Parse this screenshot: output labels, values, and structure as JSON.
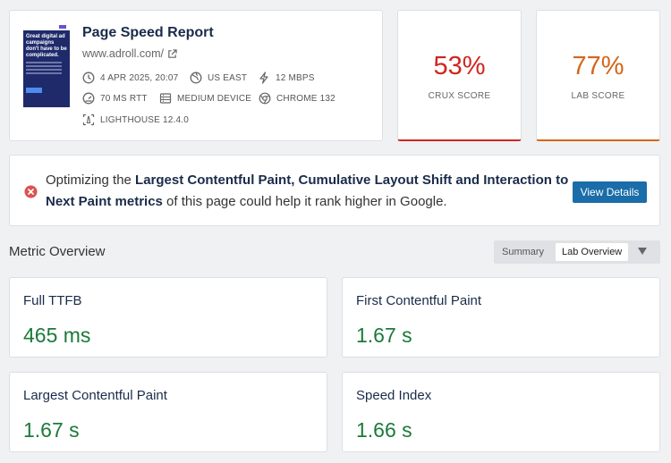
{
  "report": {
    "title": "Page Speed Report",
    "url": "www.adroll.com/",
    "thumbnail_headline": "Great digital ad campaigns don't have to be complicated.",
    "meta": {
      "date": "4 APR 2025, 20:07",
      "location": "US EAST",
      "bandwidth": "12 MBPS",
      "rtt": "70 MS RTT",
      "device": "MEDIUM DEVICE",
      "browser": "CHROME 132",
      "lighthouse": "LIGHTHOUSE 12.4.0"
    }
  },
  "scores": {
    "crux": {
      "value": "53%",
      "label": "CRUX SCORE",
      "color": "#d0251e"
    },
    "lab": {
      "value": "77%",
      "label": "LAB SCORE",
      "color": "#d4661a"
    }
  },
  "alert": {
    "prefix": "Optimizing the ",
    "emphasis": "Largest Contentful Paint, Cumulative Layout Shift and Interaction to Next Paint metrics",
    "suffix": " of this page could help it rank higher in Google.",
    "button_label": "View Details"
  },
  "overview": {
    "title": "Metric Overview",
    "toggle": {
      "option1": "Summary",
      "option2": "Lab Overview"
    }
  },
  "metrics": [
    {
      "name": "Full TTFB",
      "value": "465 ms"
    },
    {
      "name": "First Contentful Paint",
      "value": "1.67 s"
    },
    {
      "name": "Largest Contentful Paint",
      "value": "1.67 s"
    },
    {
      "name": "Speed Index",
      "value": "1.66 s"
    }
  ],
  "colors": {
    "good": "#1b7a3a",
    "accent": "#1a6da8",
    "error": "#d9534f"
  },
  "icons": [
    "external-link-icon",
    "clock-icon",
    "globe-icon",
    "bolt-icon",
    "gauge-icon",
    "device-icon",
    "chrome-icon",
    "lighthouse-icon",
    "error-circle-icon",
    "caret-down-icon"
  ]
}
